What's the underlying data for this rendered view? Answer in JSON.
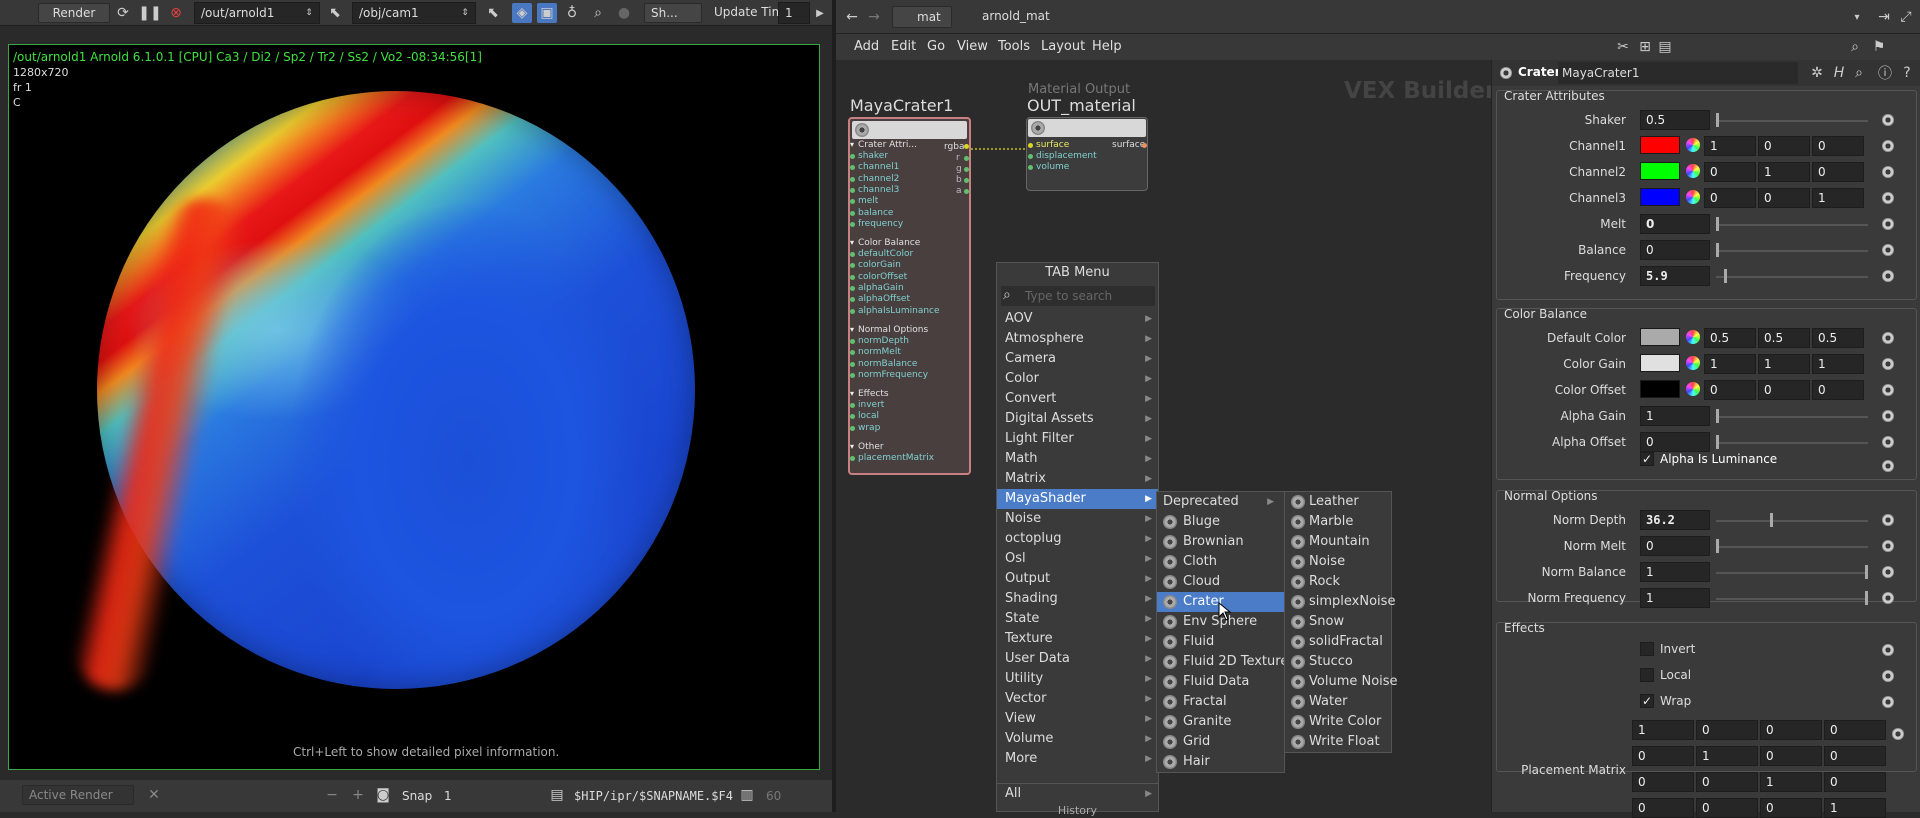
{
  "render": {
    "render_label": "Render",
    "rop_path": "/out/arnold1",
    "camera_path": "/obj/cam1",
    "shading_label": "Sh...",
    "update_time_label": "Update Time",
    "update_time_value": "1",
    "info_line": "/out/arnold1   Arnold 6.1.0.1 [CPU]  Ca3 / Di2 / Sp2 / Tr2 / Ss2 / Vo2 -08:34:56[1]",
    "resolution": "1280x720",
    "frame": "fr 1",
    "channel": "C",
    "hint": "Ctrl+Left to show detailed pixel information.",
    "active_render": "Active Render",
    "snap_label": "Snap",
    "snap_value": "1",
    "snap_path": "$HIP/ipr/$SNAPNAME.$F4",
    "snap_count": "60"
  },
  "network": {
    "context": "mat",
    "node_path": "arnold_mat",
    "menu": [
      "Add",
      "Edit",
      "Go",
      "View",
      "Tools",
      "Layout",
      "Help"
    ],
    "builder_label": "VEX Builder",
    "node1": {
      "name": "MayaCrater1",
      "output_port": "rgba",
      "out_channels": [
        "r",
        "g",
        "b",
        "a"
      ],
      "groups": [
        {
          "title": "Crater Attri...",
          "ports": [
            "shaker",
            "channel1",
            "channel2",
            "channel3",
            "melt",
            "balance",
            "frequency"
          ]
        },
        {
          "title": "Color Balance",
          "ports": [
            "defaultColor",
            "colorGain",
            "colorOffset",
            "alphaGain",
            "alphaOffset",
            "alphaIsLuminance"
          ]
        },
        {
          "title": "Normal Options",
          "ports": [
            "normDepth",
            "normMelt",
            "normBalance",
            "normFrequency"
          ]
        },
        {
          "title": "Effects",
          "ports": [
            "invert",
            "local",
            "wrap"
          ]
        },
        {
          "title": "Other",
          "ports": [
            "placementMatrix"
          ]
        }
      ]
    },
    "node2": {
      "type_label": "Material Output",
      "name": "OUT_material",
      "ports": [
        "surface",
        "displacement",
        "volume"
      ],
      "output_port": "surface"
    }
  },
  "tab_menu": {
    "title": "TAB Menu",
    "search_placeholder": "Type to search",
    "items": [
      "AOV",
      "Atmosphere",
      "Camera",
      "Color",
      "Convert",
      "Digital Assets",
      "Light Filter",
      "Math",
      "Matrix",
      "MayaShader",
      "Noise",
      "octoplug",
      "Osl",
      "Output",
      "Shading",
      "State",
      "Texture",
      "User Data",
      "Utility",
      "Vector",
      "View",
      "Volume",
      "More"
    ],
    "selected": "MayaShader",
    "all_label": "All",
    "history_label": "History",
    "sub1": [
      "Deprecated",
      "Bluge",
      "Brownian",
      "Cloth",
      "Cloud",
      "Crater",
      "Env Sphere",
      "Fluid",
      "Fluid 2D Texture",
      "Fluid Data",
      "Fractal",
      "Granite",
      "Grid",
      "Hair"
    ],
    "sub1_selected": "Crater",
    "sub2": [
      "Leather",
      "Marble",
      "Mountain",
      "Noise",
      "Rock",
      "simplexNoise",
      "Snow",
      "solidFractal",
      "Stucco",
      "Volume Noise",
      "Water",
      "Write Color",
      "Write Float"
    ]
  },
  "params": {
    "node_type": "Crater",
    "node_name": "MayaCrater1",
    "crater_section": "Crater Attributes",
    "shaker_label": "Shaker",
    "shaker": "0.5",
    "channel1_label": "Channel1",
    "channel1": [
      "1",
      "0",
      "0"
    ],
    "channel1_color": "#ff0000",
    "channel2_label": "Channel2",
    "channel2": [
      "0",
      "1",
      "0"
    ],
    "channel2_color": "#00ff00",
    "channel3_label": "Channel3",
    "channel3": [
      "0",
      "0",
      "1"
    ],
    "channel3_color": "#0000ff",
    "melt_label": "Melt",
    "melt": "0",
    "balance_label": "Balance",
    "balance": "0",
    "frequency_label": "Frequency",
    "frequency": "5.9",
    "color_balance_section": "Color Balance",
    "default_color_label": "Default Color",
    "default_color": [
      "0.5",
      "0.5",
      "0.5"
    ],
    "default_color_swatch": "#aaaaaa",
    "color_gain_label": "Color Gain",
    "color_gain": [
      "1",
      "1",
      "1"
    ],
    "color_gain_swatch": "#e0e0e0",
    "color_offset_label": "Color Offset",
    "color_offset": [
      "0",
      "0",
      "0"
    ],
    "color_offset_swatch": "#000000",
    "alpha_gain_label": "Alpha Gain",
    "alpha_gain": "1",
    "alpha_offset_label": "Alpha Offset",
    "alpha_offset": "0",
    "alpha_is_luminance_label": "Alpha Is Luminance",
    "normal_section": "Normal Options",
    "norm_depth_label": "Norm Depth",
    "norm_depth": "36.2",
    "norm_melt_label": "Norm Melt",
    "norm_melt": "0",
    "norm_balance_label": "Norm Balance",
    "norm_balance": "1",
    "norm_frequency_label": "Norm Frequency",
    "norm_frequency": "1",
    "effects_section": "Effects",
    "invert_label": "Invert",
    "local_label": "Local",
    "wrap_label": "Wrap",
    "placement_matrix_label": "Placement Matrix",
    "placement_matrix": [
      [
        "1",
        "0",
        "0",
        "0"
      ],
      [
        "0",
        "1",
        "0",
        "0"
      ],
      [
        "0",
        "0",
        "1",
        "0"
      ],
      [
        "0",
        "0",
        "0",
        "1"
      ]
    ]
  }
}
